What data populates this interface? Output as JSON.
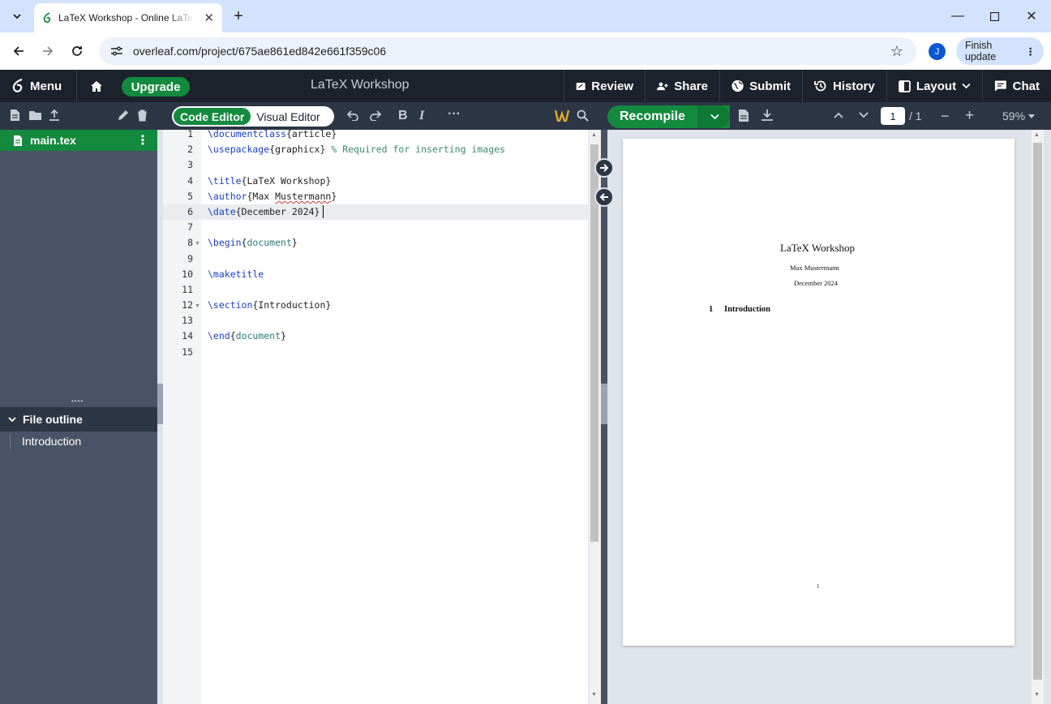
{
  "browser": {
    "tab_title": "LaTeX Workshop - Online LaTeX Editor",
    "url": "overleaf.com/project/675ae861ed842e661f359c06",
    "finish_update_label": "Finish update",
    "avatar_letter": "J"
  },
  "header": {
    "menu_label": "Menu",
    "upgrade_label": "Upgrade",
    "project_title": "LaTeX Workshop",
    "review_label": "Review",
    "share_label": "Share",
    "submit_label": "Submit",
    "history_label": "History",
    "layout_label": "Layout",
    "chat_label": "Chat"
  },
  "toolbar": {
    "code_editor_label": "Code Editor",
    "visual_editor_label": "Visual Editor",
    "recompile_label": "Recompile",
    "page_current": "1",
    "page_total": "/ 1",
    "zoom": "59%"
  },
  "filetree": {
    "file_name": "main.tex",
    "outline_title": "File outline",
    "outline_items": [
      "Introduction"
    ]
  },
  "editor": {
    "line_numbers": [
      "1",
      "2",
      "3",
      "4",
      "5",
      "6",
      "7",
      "8",
      "9",
      "10",
      "11",
      "12",
      "13",
      "14",
      "15"
    ],
    "lines": {
      "l1_cmd": "\\documentclass",
      "l1_arg": "{article}",
      "l2_cmd": "\\usepackage",
      "l2_arg": "{graphicx}",
      "l2_comment": " % Required for inserting images",
      "l4_cmd": "\\title",
      "l4_arg": "{LaTeX Workshop}",
      "l5_cmd": "\\author",
      "l5_arg_a": "{Max ",
      "l5_arg_b": "Mustermann",
      "l5_arg_c": "}",
      "l6_cmd": "\\date",
      "l6_arg": "{December 2024}",
      "l8_cmd": "\\begin",
      "l8_open": "{",
      "l8_arg": "document",
      "l8_close": "}",
      "l10_cmd": "\\maketitle",
      "l12_cmd": "\\section",
      "l12_arg": "{Introduction}",
      "l14_cmd": "\\end",
      "l14_open": "{",
      "l14_arg": "document",
      "l14_close": "}"
    }
  },
  "pdf": {
    "title": "LaTeX Workshop",
    "author": "Max Mustermann",
    "date": "December 2024",
    "section_number": "1",
    "section_title": "Introduction",
    "page_number": "1"
  }
}
